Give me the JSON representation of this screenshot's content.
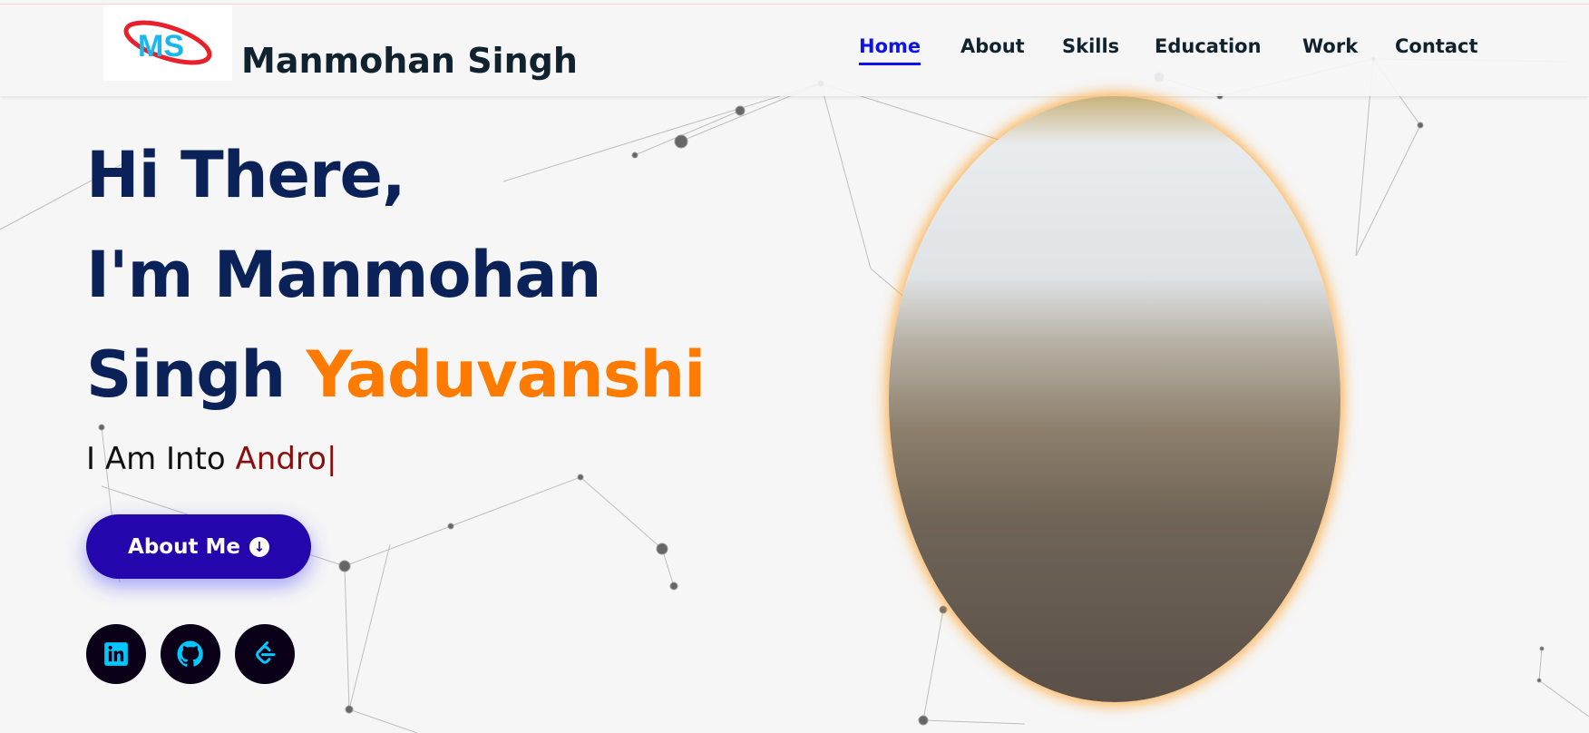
{
  "header": {
    "logo_text": "MS",
    "brand": "Manmohan Singh",
    "nav": [
      {
        "label": "Home",
        "active": true
      },
      {
        "label": "About"
      },
      {
        "label": "Skills"
      },
      {
        "label": "Education"
      },
      {
        "label": "Work"
      },
      {
        "label": "Contact"
      }
    ]
  },
  "hero": {
    "line1": "Hi There,",
    "line2": "I'm Manmohan",
    "line3a": "Singh ",
    "line3b": "Yaduvanshi",
    "typed_prefix": "I Am Into ",
    "typed_value": "Andro|",
    "button": "About Me"
  },
  "social": [
    "linkedin-icon",
    "github-icon",
    "leetcode-icon"
  ]
}
